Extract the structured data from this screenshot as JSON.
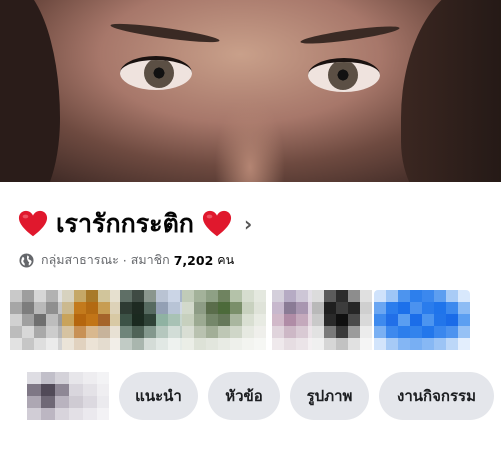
{
  "group": {
    "name": "เรารักกระติก",
    "privacy": "กลุ่มสาธารณะ",
    "separator": "·",
    "members_label": "สมาชิก",
    "member_count": "7,202",
    "member_unit": "คน"
  },
  "icons": {
    "title_left": "heart-icon",
    "title_right": "heart-icon",
    "chevron": "chevron-right-icon",
    "privacy": "globe-icon"
  },
  "colors": {
    "heart": "#e0182d",
    "chip_bg": "#e4e6eb",
    "secondary_text": "#65676b"
  },
  "tabs": [
    {
      "label": "แนะนำ"
    },
    {
      "label": "หัวข้อ"
    },
    {
      "label": "รูปภาพ"
    },
    {
      "label": "งานกิจกรรม"
    }
  ]
}
